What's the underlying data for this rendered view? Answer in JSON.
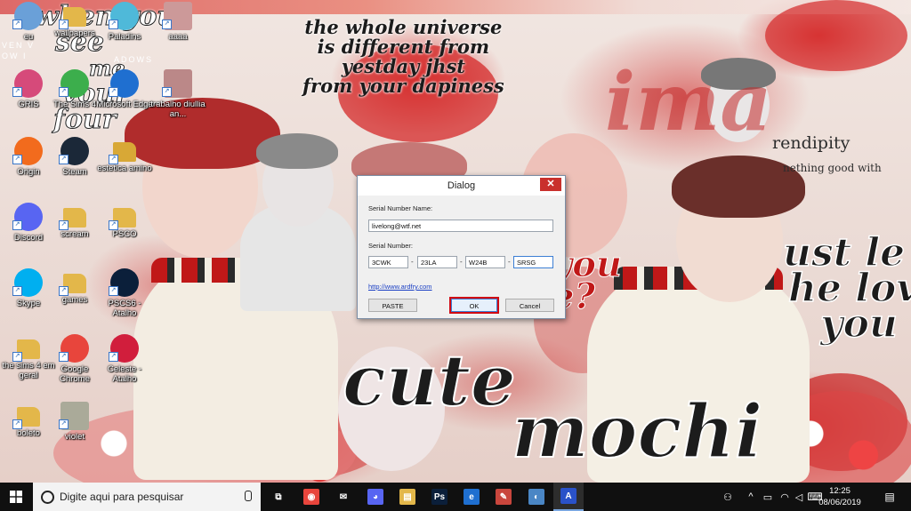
{
  "wallpaper": {
    "quote": [
      "the whole universe",
      "is different from",
      "yestday jhst",
      "from your dapiness"
    ],
    "left_text": [
      "when you",
      "see",
      "me",
      "vour",
      "four"
    ],
    "left_small": [
      "VEN  V",
      "OW  I",
      "ADOWS"
    ],
    "big_words": [
      "cute",
      "mochi"
    ],
    "right_text": [
      "ust le",
      "he lov",
      "you"
    ],
    "mid_text": [
      "you",
      "e?"
    ],
    "script_title": "ima",
    "serendipity": "rendipity",
    "serendipity_sub": "nething good with"
  },
  "desktop_icons": [
    {
      "label": "eu",
      "icon": "recycle-bin-icon",
      "color": "#6aa0d8"
    },
    {
      "label": "wallpapers",
      "icon": "folder-icon",
      "color": "#e3b74a"
    },
    {
      "label": "Paladins",
      "icon": "paladins-icon",
      "color": "#4fb9d9"
    },
    {
      "label": "aaaa",
      "icon": "image-icon",
      "color": "#c99"
    },
    {
      "label": "GRIS",
      "icon": "gris-icon",
      "color": "#d64a7a"
    },
    {
      "label": "The Sims 4",
      "icon": "sims-icon",
      "color": "#3cae4c"
    },
    {
      "label": "Microsoft Edge",
      "icon": "edge-icon",
      "color": "#1f6fd0"
    },
    {
      "label": "trabalho diullia an...",
      "icon": "image-icon",
      "color": "#b88"
    },
    {
      "label": "Origin",
      "icon": "origin-icon",
      "color": "#f26b1d"
    },
    {
      "label": "Steam",
      "icon": "steam-icon",
      "color": "#1b2838"
    },
    {
      "label": "estetica amino",
      "icon": "zip-folder-icon",
      "color": "#d8a836"
    },
    {
      "label": "Discord",
      "icon": "discord-icon",
      "color": "#5865f2"
    },
    {
      "label": "scream",
      "icon": "folder-icon",
      "color": "#e3b74a"
    },
    {
      "label": "PSCO",
      "icon": "folder-icon",
      "color": "#e3b74a"
    },
    {
      "label": "Skype",
      "icon": "skype-icon",
      "color": "#00aff0"
    },
    {
      "label": "games",
      "icon": "folder-icon",
      "color": "#e3b74a"
    },
    {
      "label": "PSCS6 - Atalho",
      "icon": "photoshop-icon",
      "color": "#0b1f3a"
    },
    {
      "label": "the sims 4 em geral",
      "icon": "folder-icon",
      "color": "#e3b74a"
    },
    {
      "label": "Google Chrome",
      "icon": "chrome-icon",
      "color": "#e8453c"
    },
    {
      "label": "Celeste - Atalho",
      "icon": "strawberry-icon",
      "color": "#d11e3c"
    },
    {
      "label": "boleto",
      "icon": "folder-icon",
      "color": "#e3b74a"
    },
    {
      "label": "violet",
      "icon": "image-icon",
      "color": "#aa9"
    }
  ],
  "dialog": {
    "title": "Dialog",
    "close": "✕",
    "name_label": "Serial Number Name:",
    "name_value": "livelong@wtf.net",
    "serial_label": "Serial Number:",
    "serial": [
      "3CWK",
      "23LA",
      "W24B",
      "SRSG"
    ],
    "dash": "-",
    "link": "http://www.ardfry.com",
    "paste": "PASTE",
    "ok": "OK",
    "cancel": "Cancel"
  },
  "taskbar": {
    "search_placeholder": "Digite aqui para pesquisar",
    "apps": [
      {
        "icon": "task-view-icon",
        "glyph": "⧉",
        "color": "transparent"
      },
      {
        "icon": "chrome-icon",
        "glyph": "◉",
        "color": "#e8453c"
      },
      {
        "icon": "mail-icon",
        "glyph": "✉",
        "color": "transparent"
      },
      {
        "icon": "discord-icon",
        "glyph": "◕",
        "color": "#5865f2"
      },
      {
        "icon": "file-explorer-icon",
        "glyph": "▤",
        "color": "#e3b74a"
      },
      {
        "icon": "photoshop-icon",
        "glyph": "Ps",
        "color": "#0b1f3a"
      },
      {
        "icon": "edge-icon",
        "glyph": "e",
        "color": "#1f6fd0"
      },
      {
        "icon": "paint-icon",
        "glyph": "✎",
        "color": "#c9463d"
      },
      {
        "icon": "paint-palette-icon",
        "glyph": "◐",
        "color": "#4a86c5"
      },
      {
        "icon": "keygen-app-icon",
        "glyph": "A",
        "color": "#2a52c9"
      }
    ],
    "tray": {
      "people": "⚇",
      "chevron": "^",
      "network": "▭",
      "speaker": "◁",
      "keyboard": "⌨"
    },
    "time": "12:25",
    "date": "08/06/2019",
    "notifications": "▤"
  }
}
